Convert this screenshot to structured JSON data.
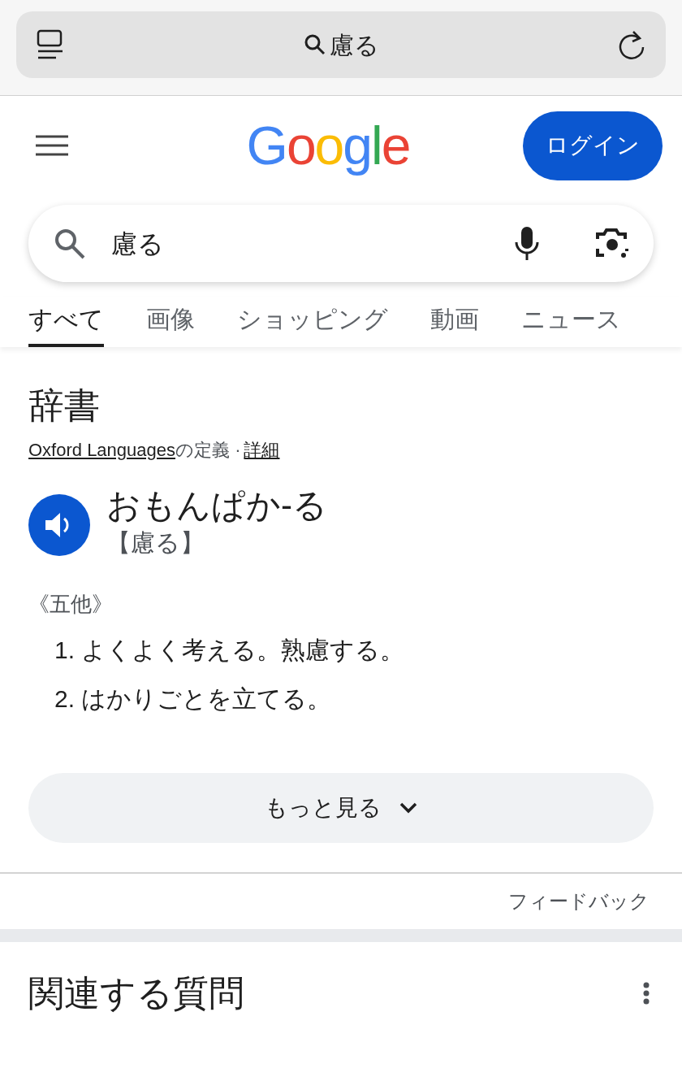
{
  "address_bar": {
    "query": "慮る"
  },
  "header": {
    "logo": "Google",
    "login_button": "ログイン"
  },
  "search": {
    "value": "慮る"
  },
  "tabs": [
    {
      "label": "すべて",
      "selected": true
    },
    {
      "label": "画像",
      "selected": false
    },
    {
      "label": "ショッピング",
      "selected": false
    },
    {
      "label": "動画",
      "selected": false
    },
    {
      "label": "ニュース",
      "selected": false
    }
  ],
  "dictionary": {
    "title": "辞書",
    "source_link": "Oxford Languages",
    "source_suffix": "の定義 ·",
    "details_link": "詳細",
    "word": "おもんぱか-る",
    "kanji": "【慮る】",
    "part_of_speech": "《五他》",
    "definitions": [
      {
        "number": "1.",
        "text": "よくよく考える。熟慮する。"
      },
      {
        "number": "2.",
        "text": "はかりごとを立てる。"
      }
    ],
    "more_button": "もっと見る",
    "feedback": "フィードバック"
  },
  "related": {
    "title": "関連する質問"
  }
}
